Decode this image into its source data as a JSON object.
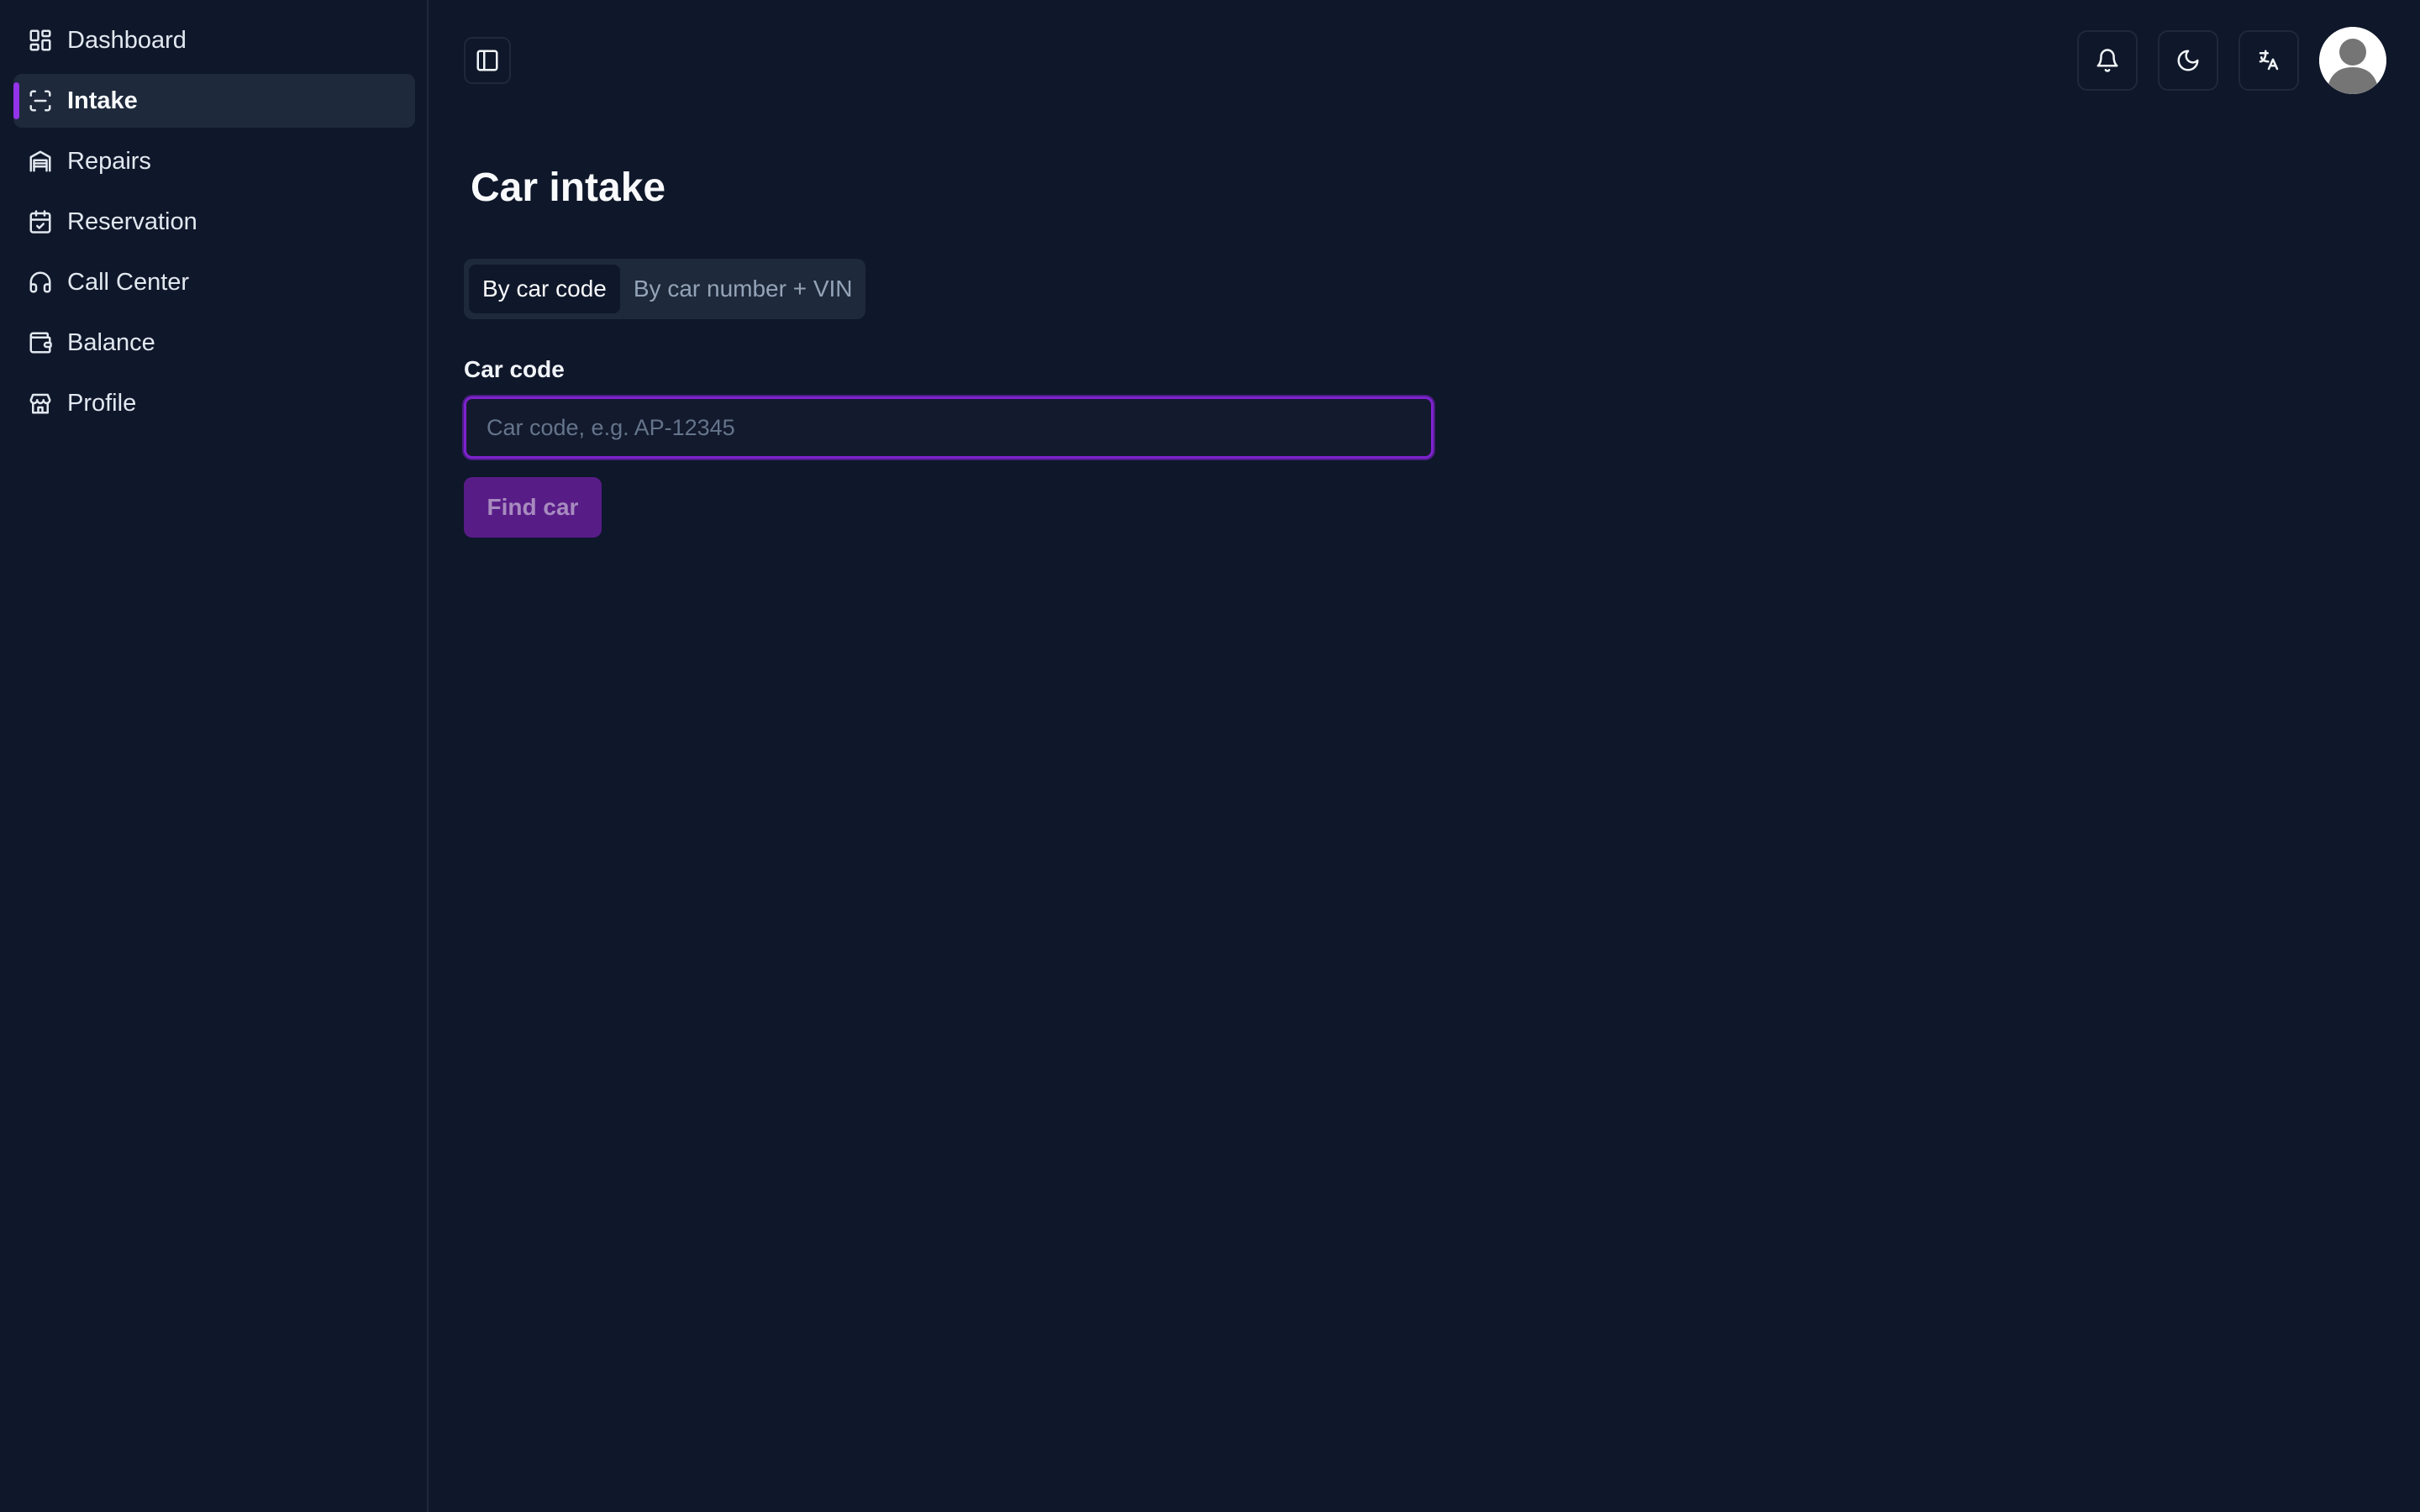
{
  "sidebar": {
    "items": [
      {
        "label": "Dashboard",
        "icon": "dashboard-icon"
      },
      {
        "label": "Intake",
        "icon": "scan-icon",
        "active": true
      },
      {
        "label": "Repairs",
        "icon": "garage-icon"
      },
      {
        "label": "Reservation",
        "icon": "calendar-check-icon"
      },
      {
        "label": "Call Center",
        "icon": "headset-icon"
      },
      {
        "label": "Balance",
        "icon": "wallet-icon"
      },
      {
        "label": "Profile",
        "icon": "store-icon"
      }
    ]
  },
  "header": {
    "sidebar_toggle_icon": "panel-left-icon",
    "notification_icon": "bell-icon",
    "theme_icon": "moon-icon",
    "language_icon": "translate-icon",
    "avatar_icon": "user-avatar-icon"
  },
  "main": {
    "title": "Car intake",
    "tabs": [
      {
        "label": "By car code",
        "active": true
      },
      {
        "label": "By car number + VIN",
        "active": false
      }
    ],
    "field_label": "Car code",
    "input": {
      "value": "",
      "placeholder": "Car code, e.g. AP-12345"
    },
    "submit_label": "Find car"
  },
  "colors": {
    "background": "#0f172a",
    "surface": "#1e293b",
    "accent": "#9333ea",
    "button": "#581c87"
  }
}
